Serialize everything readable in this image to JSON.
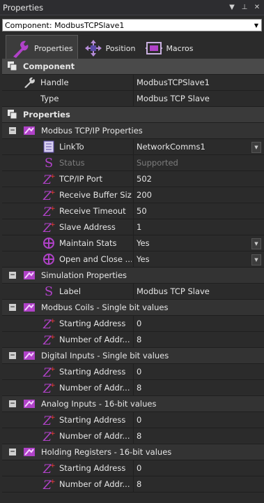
{
  "window": {
    "title": "Properties"
  },
  "component_select": {
    "value": "Component: ModbusTCPSlave1"
  },
  "tabs": [
    {
      "label": "Properties",
      "icon": "wrench-icon"
    },
    {
      "label": "Position",
      "icon": "move-icon"
    },
    {
      "label": "Macros",
      "icon": "macros-icon"
    }
  ],
  "component_section": {
    "title": "Component",
    "handle": {
      "label": "Handle",
      "value": "ModbusTCPSlave1"
    },
    "type": {
      "label": "Type",
      "value": "Modbus TCP Slave"
    }
  },
  "properties_section": {
    "title": "Properties",
    "modbus": {
      "title": "Modbus TCP/IP Properties",
      "rows": [
        {
          "label": "LinkTo",
          "value": "NetworkComms1"
        },
        {
          "label": "Status",
          "value": "Supported"
        },
        {
          "label": "TCP/IP Port",
          "value": "502"
        },
        {
          "label": "Receive Buffer Size",
          "value": "200"
        },
        {
          "label": "Receive Timeout",
          "value": "50"
        },
        {
          "label": "Slave Address",
          "value": "1"
        },
        {
          "label": "Maintain Stats",
          "value": "Yes"
        },
        {
          "label": "Open and Close ...",
          "value": "Yes"
        }
      ]
    },
    "simulation": {
      "title": "Simulation Properties",
      "rows": [
        {
          "label": "Label",
          "value": "Modbus TCP Slave"
        }
      ]
    },
    "coils": {
      "title": "Modbus Coils - Single bit values",
      "rows": [
        {
          "label": "Starting Address",
          "value": "0"
        },
        {
          "label": "Number of Addr...",
          "value": "8"
        }
      ]
    },
    "digital": {
      "title": "Digital Inputs - Single bit values",
      "rows": [
        {
          "label": "Starting Address",
          "value": "0"
        },
        {
          "label": "Number of Addr...",
          "value": "8"
        }
      ]
    },
    "analog": {
      "title": "Analog Inputs - 16-bit values",
      "rows": [
        {
          "label": "Starting Address",
          "value": "0"
        },
        {
          "label": "Number of Addr...",
          "value": "8"
        }
      ]
    },
    "holding": {
      "title": "Holding Registers - 16-bit values",
      "rows": [
        {
          "label": "Starting Address",
          "value": "0"
        },
        {
          "label": "Number of Addr...",
          "value": "8"
        }
      ]
    }
  },
  "colors": {
    "accent": "#b042c8",
    "background": "#2b2b2b"
  }
}
